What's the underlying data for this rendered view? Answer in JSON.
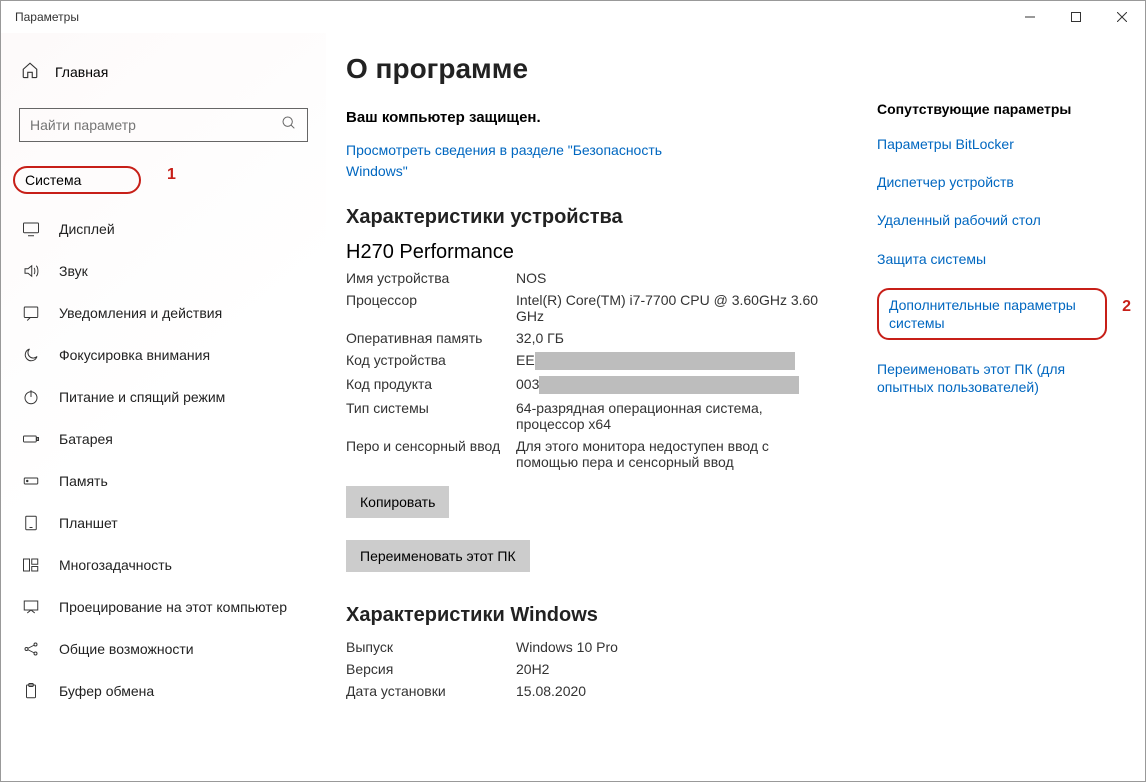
{
  "window": {
    "title": "Параметры"
  },
  "sidebar": {
    "home_label": "Главная",
    "search_placeholder": "Найти параметр",
    "category_label": "Система",
    "items": [
      {
        "label": "Дисплей"
      },
      {
        "label": "Звук"
      },
      {
        "label": "Уведомления и действия"
      },
      {
        "label": "Фокусировка внимания"
      },
      {
        "label": "Питание и спящий режим"
      },
      {
        "label": "Батарея"
      },
      {
        "label": "Память"
      },
      {
        "label": "Планшет"
      },
      {
        "label": "Многозадачность"
      },
      {
        "label": "Проецирование на этот компьютер"
      },
      {
        "label": "Общие возможности"
      },
      {
        "label": "Буфер обмена"
      }
    ]
  },
  "main": {
    "title": "О программе",
    "protected_heading": "Ваш компьютер защищен.",
    "security_link": "Просмотреть сведения в разделе \"Безопасность Windows\"",
    "device_specs_heading": "Характеристики устройства",
    "device_name_big": "H270 Performance",
    "specs": {
      "device_name_label": "Имя устройства",
      "device_name_value": "NOS",
      "processor_label": "Процессор",
      "processor_value": "Intel(R) Core(TM) i7-7700 CPU @ 3.60GHz 3.60 GHz",
      "ram_label": "Оперативная память",
      "ram_value": "32,0 ГБ",
      "device_id_label": "Код устройства",
      "device_id_prefix": "EE",
      "product_id_label": "Код продукта",
      "product_id_prefix": "003",
      "system_type_label": "Тип системы",
      "system_type_value": "64-разрядная операционная система, процессор x64",
      "pen_touch_label": "Перо и сенсорный ввод",
      "pen_touch_value": "Для этого монитора недоступен ввод с помощью пера и сенсорный ввод"
    },
    "copy_button": "Копировать",
    "rename_button": "Переименовать этот ПК",
    "windows_specs_heading": "Характеристики Windows",
    "win": {
      "edition_label": "Выпуск",
      "edition_value": "Windows 10 Pro",
      "version_label": "Версия",
      "version_value": "20H2",
      "install_date_label": "Дата установки",
      "install_date_value": "15.08.2020"
    }
  },
  "related": {
    "heading": "Сопутствующие параметры",
    "links": {
      "bitlocker": "Параметры BitLocker",
      "devmgr": "Диспетчер устройств",
      "rdp": "Удаленный рабочий стол",
      "sysprotect": "Защита системы",
      "advanced": "Дополнительные параметры системы",
      "rename": "Переименовать этот ПК (для опытных пользователей)"
    }
  },
  "annotations": {
    "n1": "1",
    "n2": "2"
  }
}
